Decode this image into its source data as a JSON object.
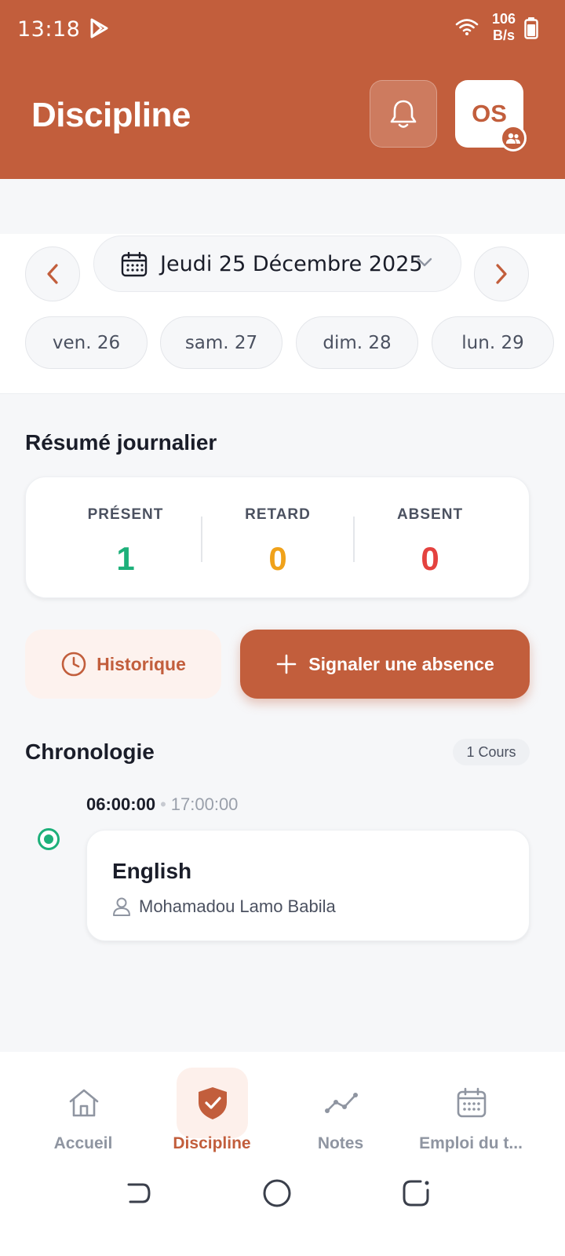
{
  "status_bar": {
    "time": "13:18",
    "speed_value": "106",
    "speed_unit": "B/s"
  },
  "header": {
    "title": "Discipline",
    "avatar_initials": "OS"
  },
  "date_nav": {
    "current_date": "Jeudi 25 Décembre 2025",
    "days": [
      "ven. 26",
      "sam. 27",
      "dim. 28",
      "lun. 29"
    ]
  },
  "summary": {
    "title": "Résumé journalier",
    "stats": [
      {
        "label": "PRÉSENT",
        "value": "1",
        "color": "#1db07a"
      },
      {
        "label": "RETARD",
        "value": "0",
        "color": "#f0a21a"
      },
      {
        "label": "ABSENT",
        "value": "0",
        "color": "#e4423f"
      }
    ]
  },
  "actions": {
    "history_label": "Historique",
    "report_label": "Signaler une absence"
  },
  "timeline": {
    "title": "Chronologie",
    "count_label": "1 Cours",
    "entries": [
      {
        "start": "06:00:00",
        "end": "17:00:00",
        "course": "English",
        "teacher": "Mohamadou Lamo Babila"
      }
    ]
  },
  "bottom_nav": {
    "items": [
      {
        "label": "Accueil",
        "icon": "home-icon"
      },
      {
        "label": "Discipline",
        "icon": "shield-check-icon"
      },
      {
        "label": "Notes",
        "icon": "trend-icon"
      },
      {
        "label": "Emploi du t...",
        "icon": "calendar-icon"
      }
    ],
    "active_index": 1
  },
  "colors": {
    "accent": "#c25e3c",
    "present": "#1db07a",
    "late": "#f0a21a",
    "absent": "#e4423f"
  }
}
